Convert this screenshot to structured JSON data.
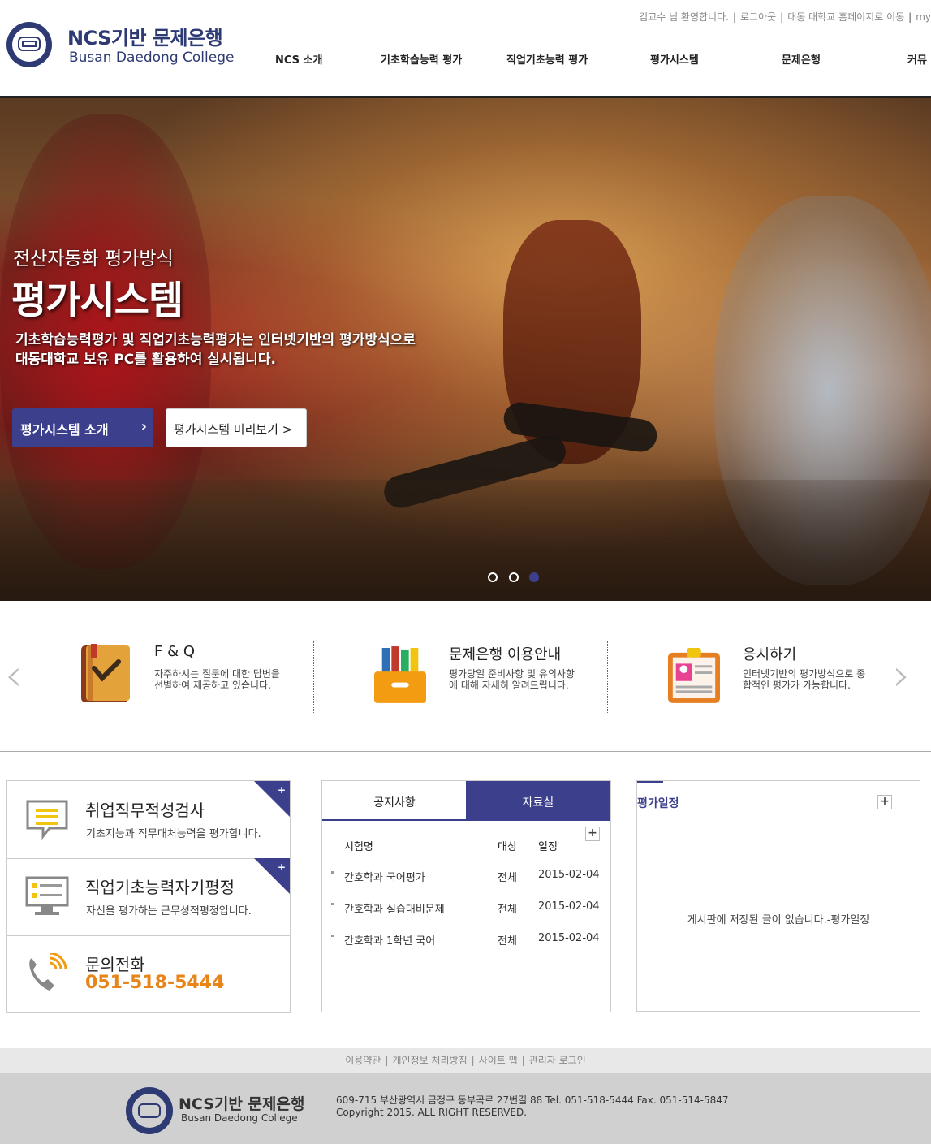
{
  "header": {
    "welcome": "김교수 님 환영합니다.",
    "logout": "로그아웃",
    "homepage": "대동 대학교 홈페이지로 이동",
    "my": "my",
    "logo_title": "NCS기반 문제은행",
    "logo_sub": "Busan Daedong College",
    "nav": [
      "NCS 소개",
      "기초학습능력 평가",
      "직업기초능력 평가",
      "평가시스템",
      "문제은행",
      "커뮤"
    ]
  },
  "hero": {
    "subtitle": "전산자동화 평가방식",
    "title": "평가시스템",
    "desc_line1": "기초학습능력평가 및 직업기초능력평가는 인터넷기반의 평가방식으로",
    "desc_line2": "대동대학교 보유 PC를 활용하여 실시됩니다.",
    "btn_intro": "평가시스템 소개",
    "btn_preview": "평가시스템 미리보기 >",
    "slide_active": 3,
    "slide_count": 3
  },
  "quick": {
    "items": [
      {
        "title": "F & Q",
        "desc": "자주하시는 질문에 대한 답변을 선별하여 제공하고 있습니다.",
        "icon": "book-check-icon"
      },
      {
        "title": "문제은행 이용안내",
        "desc": "평가당일 준비사항 및 유의사항에 대해 자세히 알려드립니다.",
        "icon": "file-box-icon"
      },
      {
        "title": "응시하기",
        "desc": "인터넷기반의 평가방식으로 종합적인 평가가 가능합니다.",
        "icon": "clipboard-profile-icon"
      }
    ]
  },
  "left_panel": {
    "aptitude_title": "취업직무적성검사",
    "aptitude_desc": "기초지능과 직무대처능력을 평가합니다.",
    "self_title": "직업기초능력자기평정",
    "self_desc": "자신을 평가하는 근무성적평정입니다.",
    "phone_title": "문의전화",
    "phone_number": "051-518-5444"
  },
  "board": {
    "tab_notice": "공지사항",
    "tab_data": "자료실",
    "headers": [
      "시험명",
      "대상",
      "일정"
    ],
    "rows": [
      {
        "name": "간호학과 국어평가",
        "target": "전체",
        "date": "2015-02-04"
      },
      {
        "name": "간호학과 실습대비문제",
        "target": "전체",
        "date": "2015-02-04"
      },
      {
        "name": "간호학과 1학년 국어",
        "target": "전체",
        "date": "2015-02-04"
      }
    ]
  },
  "schedule": {
    "title": "평가일정",
    "empty": "게시판에 저장된 글이 없습니다.-평가일정"
  },
  "footer": {
    "links": [
      "이용약관",
      "개인정보 처리방침",
      "사이트 맵",
      "관리자 로그인"
    ],
    "logo_title": "NCS기반 문제은행",
    "logo_sub": "Busan Daedong College",
    "address": "609-715 부산광역시 금정구 동부곡로 27번길 88 Tel. 051-518-5444 Fax. 051-514-5847",
    "copyright": "Copyright 2015. ALL RIGHT RESERVED."
  },
  "colors": {
    "brand": "#3b3f8c",
    "phone": "#e8851a"
  }
}
